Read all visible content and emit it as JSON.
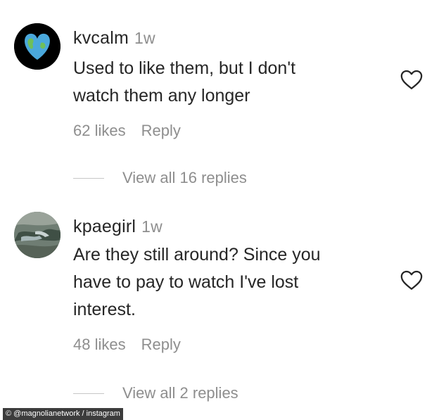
{
  "comments": [
    {
      "username": "kvcalm",
      "time": "1w",
      "text_lines": [
        "Used to like them, but I don't",
        "watch them any longer"
      ],
      "likes": "62 likes",
      "reply": "Reply",
      "view_replies": "View all 16 replies",
      "avatar_icon": "blue-heart-earth-icon"
    },
    {
      "username": "kpaegirl",
      "time": "1w",
      "text_lines": [
        "Are they still around? Since you",
        "have to pay to watch I've lost",
        "interest."
      ],
      "likes": "48 likes",
      "reply": "Reply",
      "view_replies": "View all 2 replies",
      "avatar_icon": "photo-avatar"
    }
  ],
  "credit": "© @magnolianetwork / instagram",
  "colors": {
    "text": "#262626",
    "secondary": "#8e8e8e",
    "heart_outline": "#262626"
  }
}
